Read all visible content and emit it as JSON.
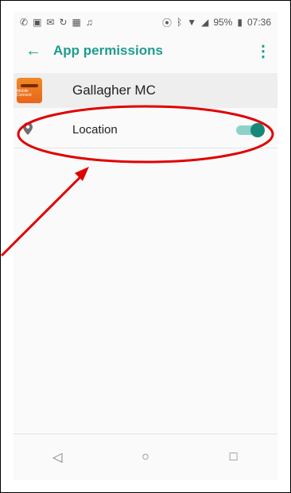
{
  "status_bar": {
    "icons_left": [
      "✆",
      "▣",
      "✉",
      "↻",
      "▦",
      "♫"
    ],
    "right": {
      "battery_percent": "95%",
      "time": "07:36"
    }
  },
  "app_bar": {
    "back_icon": "arrow-left-icon",
    "title": "App permissions",
    "menu_icon": "more-vert-icon"
  },
  "app": {
    "name": "Gallagher MC",
    "logo_text": "Mobile Connect"
  },
  "permission": {
    "icon": "location-pin-icon",
    "label": "Location",
    "enabled": true
  },
  "nav": {
    "back": "◁",
    "home": "○",
    "recents": "□"
  },
  "annotation": {
    "color": "#e10000"
  },
  "colors": {
    "accent": "#1f9c8e",
    "toggle_on": "#16887a"
  }
}
